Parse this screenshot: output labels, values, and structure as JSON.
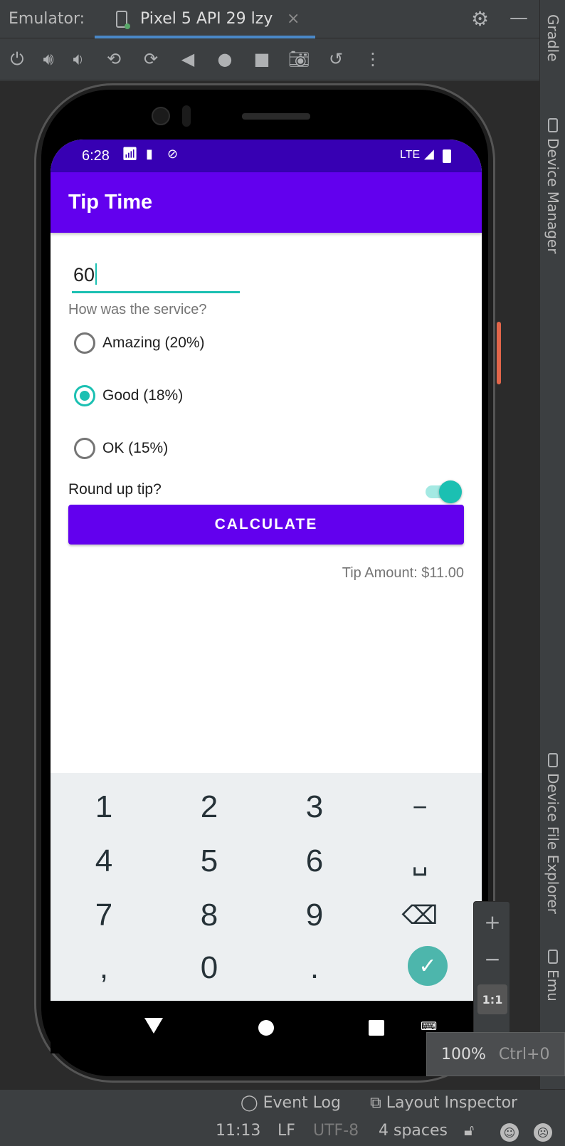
{
  "ide": {
    "emulator_label": "Emulator:",
    "tab_title": "Pixel 5 API 29 lzy",
    "tab_close": "×",
    "toolbar_icons": [
      "power-icon",
      "volume-up-icon",
      "volume-down-icon",
      "rotate-left-icon",
      "rotate-right-icon",
      "back-icon",
      "home-icon",
      "overview-icon",
      "camera-icon",
      "snapshot-icon",
      "more-icon"
    ],
    "right_tabs": [
      "Gradle",
      "Device Manager",
      "Device File Explorer",
      "Emu"
    ],
    "bottom_tabs": {
      "event_log": "Event Log",
      "layout_inspector": "Layout Inspector"
    },
    "status": {
      "position": "11:13",
      "line_sep": "LF",
      "encoding": "UTF-8",
      "indent": "4 spaces"
    },
    "zoom": {
      "plus": "+",
      "minus": "−",
      "one_to_one": "1:1",
      "tooltip_value": "100%",
      "tooltip_shortcut": "Ctrl+0"
    }
  },
  "device": {
    "status_bar": {
      "time": "6:28",
      "network": "LTE"
    },
    "app_title": "Tip Time",
    "cost_input_value": "60",
    "service_question": "How was the service?",
    "options": [
      {
        "label": "Amazing (20%)",
        "selected": false
      },
      {
        "label": "Good (18%)",
        "selected": true
      },
      {
        "label": "OK (15%)",
        "selected": false
      }
    ],
    "round_up_label": "Round up tip?",
    "round_up_on": true,
    "calculate_label": "CALCULATE",
    "tip_amount": "Tip Amount: $11.00",
    "keypad": [
      "1",
      "2",
      "3",
      "−",
      "4",
      "5",
      "6",
      "␣",
      "7",
      "8",
      "9",
      "⌫",
      ",",
      "0",
      ".",
      "✓"
    ]
  },
  "colors": {
    "primary": "#6200ee",
    "primary_dark": "#3700b3",
    "accent": "#1bc0b2",
    "ide_bg": "#3c3f41"
  }
}
